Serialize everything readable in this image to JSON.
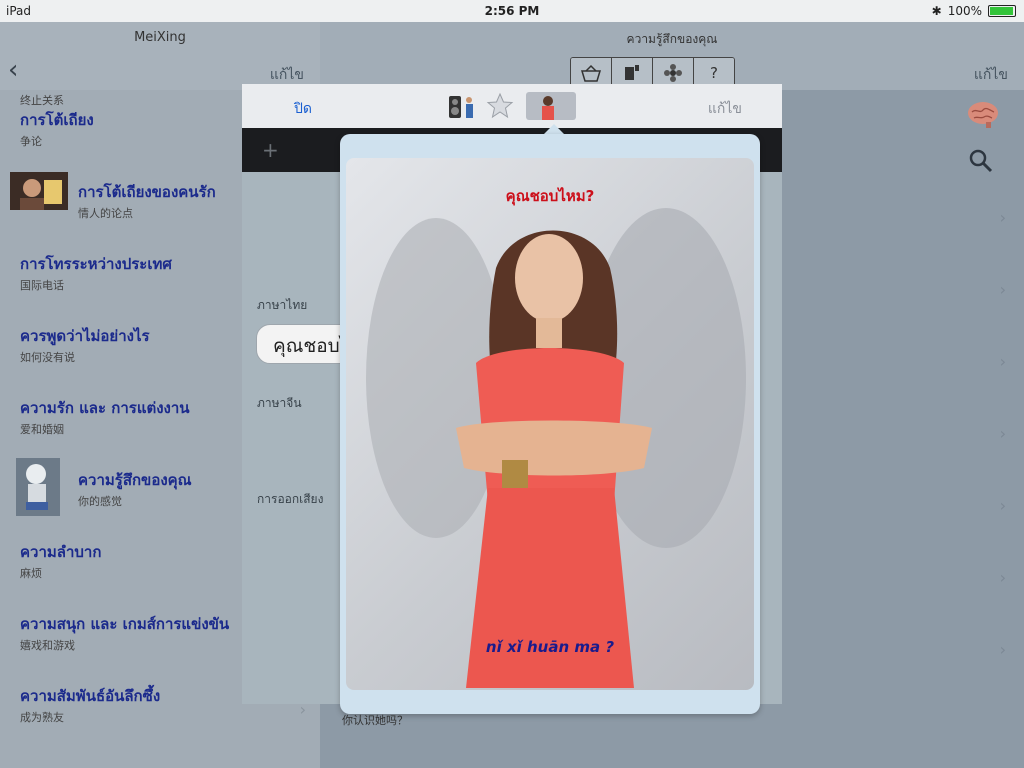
{
  "status": {
    "device": "iPad",
    "time": "2:56 PM",
    "battery": "100%"
  },
  "left": {
    "title": "MeiXing",
    "edit_label": "แก้ไข",
    "top_cut_text": "终止关系",
    "items": [
      {
        "title": "การโต้เถียง",
        "subtitle": "争论"
      },
      {
        "title": "การโต้เถียงของคนรัก",
        "subtitle": "情人的论点"
      },
      {
        "title": "การโทรระหว่างประเทศ",
        "subtitle": "国际电话"
      },
      {
        "title": "ควรพูดว่าไม่อย่างไร",
        "subtitle": "如何没有说"
      },
      {
        "title": "ความรัก และ การแต่งงาน",
        "subtitle": "爱和婚姻"
      },
      {
        "title": "ความรู้สึกของคุณ",
        "subtitle": "你的感觉"
      },
      {
        "title": "ความลำบาก",
        "subtitle": "麻烦"
      },
      {
        "title": "ความสนุก และ เกมส์การแข่งขัน",
        "subtitle": "嬉戏和游戏"
      },
      {
        "title": "ความสัมพันธ์อันลึกซึ้ง",
        "subtitle": "成为熟友"
      }
    ]
  },
  "right": {
    "title": "ความรู้สึกของคุณ",
    "edit_label": "แก้ไข",
    "segments": [
      "basket-icon",
      "sign-icon",
      "flower-icon",
      "?"
    ],
    "below_text": "你认识她吗？"
  },
  "modal": {
    "close_label": "ปิด",
    "edit_label": "แก้ไข",
    "thai_label": "ภาษาไทย",
    "chinese_label": "ภาษาจีน",
    "pron_label": "การออกเสียง",
    "bubble_text": "คุณชอบไหม?"
  },
  "popover": {
    "caption_top": "คุณชอบไหม?",
    "caption_bottom": "nǐ xǐ huān ma ?"
  },
  "colors": {
    "link": "#1a5fd1",
    "title_blue": "#1b2a8c",
    "caption_red": "#cc0f1a"
  }
}
